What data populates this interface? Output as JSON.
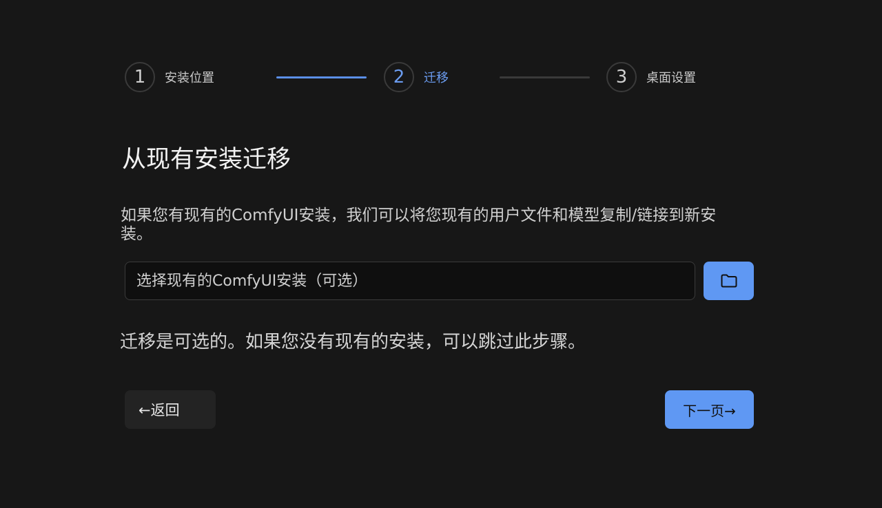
{
  "stepper": {
    "steps": [
      {
        "number": "1",
        "label": "安装位置"
      },
      {
        "number": "2",
        "label": "迁移"
      },
      {
        "number": "3",
        "label": "桌面设置"
      }
    ]
  },
  "page": {
    "title": "从现有安装迁移",
    "description": "如果您有现有的ComfyUI安装，我们可以将您现有的用户文件和模型复制/链接到新安装。",
    "input_placeholder": "选择现有的ComfyUI安装（可选）",
    "note": "迁移是可选的。如果您没有现有的安装，可以跳过此步骤。"
  },
  "icons": {
    "browse": "folder-icon"
  },
  "footer": {
    "back_label": "←返回",
    "next_label": "下一页→"
  },
  "colors": {
    "background": "#171717",
    "accent": "#5f98f3",
    "active_step_text": "#6b9cf0"
  }
}
